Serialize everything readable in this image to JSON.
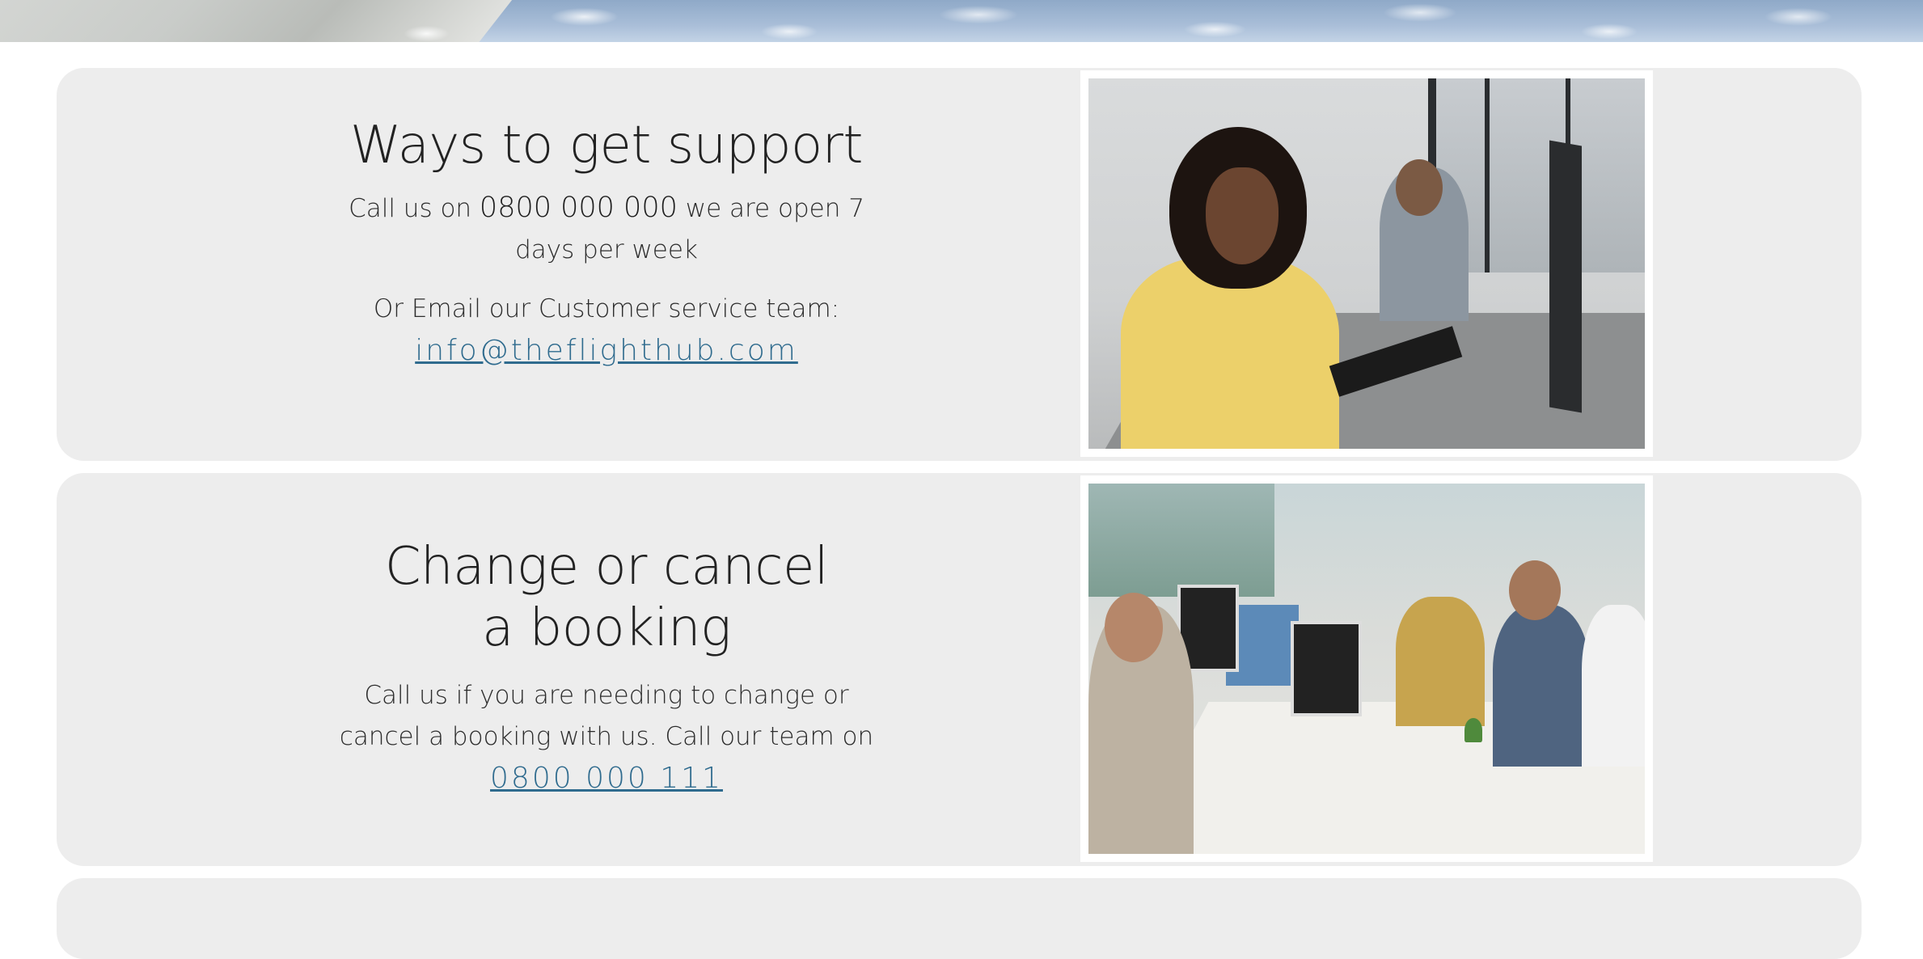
{
  "cards": [
    {
      "heading": "Ways to get support",
      "call_prefix": "Call us on ",
      "call_number": "0800 000 000",
      "call_suffix": " we are open 7 days per week",
      "email_label": "Or Email our Customer service team:",
      "email_link": "info@theflighthub.com",
      "image_alt": "support-team-photo"
    },
    {
      "heading": "Change or cancel a booking",
      "body_prefix": "Call us if you are needing to change or cancel a booking with us. Call our team on ",
      "phone_link": "0800 000 111",
      "image_alt": "office-team-photo"
    }
  ],
  "colors": {
    "card_bg": "#ededed",
    "link": "#2f6b8e",
    "text": "#2a2a2a"
  }
}
